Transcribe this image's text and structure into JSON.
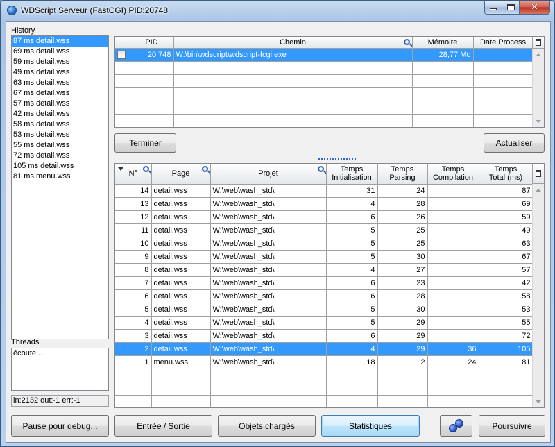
{
  "window": {
    "title": "WDScript Serveur (FastCGI) PID:20748"
  },
  "history": {
    "label": "History",
    "items": [
      "87 ms detail.wss",
      "69 ms detail.wss",
      "59 ms detail.wss",
      "49 ms detail.wss",
      "63 ms detail.wss",
      "67 ms detail.wss",
      "57 ms detail.wss",
      "42 ms detail.wss",
      "58 ms detail.wss",
      "53 ms detail.wss",
      "55 ms detail.wss",
      "72 ms detail.wss",
      "105 ms detail.wss",
      "81 ms menu.wss"
    ]
  },
  "threads": {
    "label": "Threads",
    "text": "écoute..."
  },
  "status": {
    "text": "in:2132 out:-1 err:-1"
  },
  "process_table": {
    "columns": [
      "PID",
      "Chemin",
      "Mémoire",
      "Date Process"
    ],
    "rows": [
      {
        "pid": "20 748",
        "chemin": "W:\\bin\\wdscript\\wdscript-fcgi.exe",
        "memoire": "28,77 Mo",
        "date": ""
      }
    ]
  },
  "buttons": {
    "terminer": "Terminer",
    "actualiser": "Actualiser",
    "pause": "Pause pour debug...",
    "entree_sortie": "Entrée / Sortie",
    "objets": "Objets chargés",
    "statistiques": "Statistiques",
    "poursuivre": "Poursuivre"
  },
  "stats_table": {
    "columns": {
      "num": "N°",
      "page": "Page",
      "projet": "Projet",
      "init_1": "Temps",
      "init_2": "Initialisation",
      "parse_1": "Temps",
      "parse_2": "Parsing",
      "comp_1": "Temps",
      "comp_2": "Compilation",
      "total_1": "Temps",
      "total_2": "Total (ms)"
    },
    "rows": [
      {
        "n": "14",
        "page": "detail.wss",
        "projet": "W:\\web\\wash_std\\",
        "init": "31",
        "parse": "24",
        "comp": "",
        "total": "87"
      },
      {
        "n": "13",
        "page": "detail.wss",
        "projet": "W:\\web\\wash_std\\",
        "init": "4",
        "parse": "28",
        "comp": "",
        "total": "69"
      },
      {
        "n": "12",
        "page": "detail.wss",
        "projet": "W:\\web\\wash_std\\",
        "init": "6",
        "parse": "26",
        "comp": "",
        "total": "59"
      },
      {
        "n": "11",
        "page": "detail.wss",
        "projet": "W:\\web\\wash_std\\",
        "init": "5",
        "parse": "25",
        "comp": "",
        "total": "49"
      },
      {
        "n": "10",
        "page": "detail.wss",
        "projet": "W:\\web\\wash_std\\",
        "init": "5",
        "parse": "25",
        "comp": "",
        "total": "63"
      },
      {
        "n": "9",
        "page": "detail.wss",
        "projet": "W:\\web\\wash_std\\",
        "init": "5",
        "parse": "30",
        "comp": "",
        "total": "67"
      },
      {
        "n": "8",
        "page": "detail.wss",
        "projet": "W:\\web\\wash_std\\",
        "init": "4",
        "parse": "27",
        "comp": "",
        "total": "57"
      },
      {
        "n": "7",
        "page": "detail.wss",
        "projet": "W:\\web\\wash_std\\",
        "init": "6",
        "parse": "23",
        "comp": "",
        "total": "42"
      },
      {
        "n": "6",
        "page": "detail.wss",
        "projet": "W:\\web\\wash_std\\",
        "init": "6",
        "parse": "28",
        "comp": "",
        "total": "58"
      },
      {
        "n": "5",
        "page": "detail.wss",
        "projet": "W:\\web\\wash_std\\",
        "init": "5",
        "parse": "30",
        "comp": "",
        "total": "53"
      },
      {
        "n": "4",
        "page": "detail.wss",
        "projet": "W:\\web\\wash_std\\",
        "init": "5",
        "parse": "29",
        "comp": "",
        "total": "55"
      },
      {
        "n": "3",
        "page": "detail.wss",
        "projet": "W:\\web\\wash_std\\",
        "init": "6",
        "parse": "29",
        "comp": "",
        "total": "72"
      },
      {
        "n": "2",
        "page": "detail.wss",
        "projet": "W:\\web\\wash_std\\",
        "init": "4",
        "parse": "29",
        "comp": "36",
        "total": "105"
      },
      {
        "n": "1",
        "page": "menu.wss",
        "projet": "W:\\web\\wash_std\\",
        "init": "18",
        "parse": "2",
        "comp": "24",
        "total": "81"
      }
    ]
  },
  "colors": {
    "selection": "#3399ff",
    "accent": "#3c7fb1"
  }
}
